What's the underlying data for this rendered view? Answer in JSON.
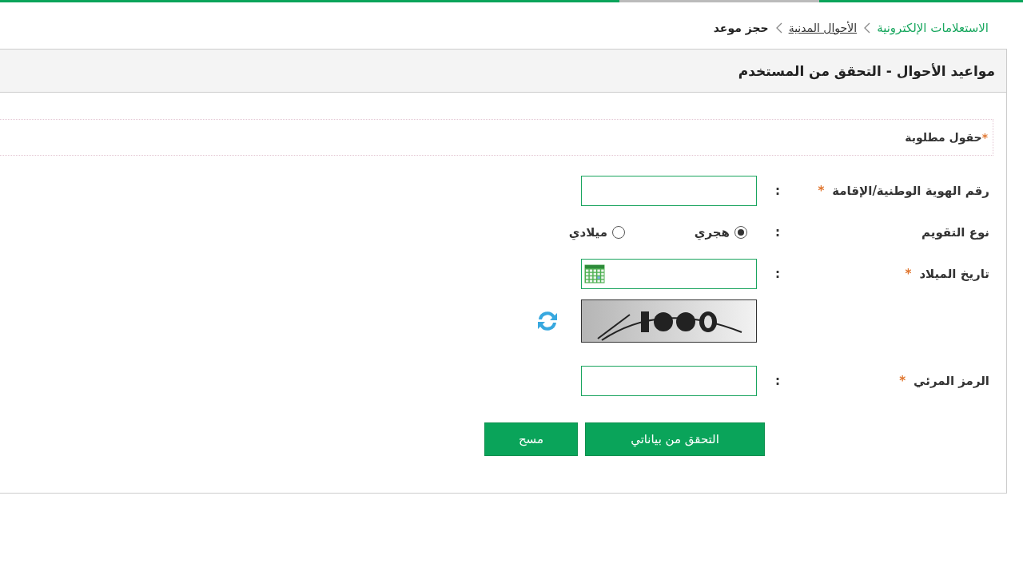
{
  "breadcrumb": [
    {
      "label": "الاستعلامات الإلكترونية",
      "kind": "link"
    },
    {
      "label": "الأحوال المدنية",
      "kind": "plain"
    },
    {
      "label": "حجز موعد",
      "kind": "current"
    }
  ],
  "panel": {
    "title": "مواعيد الأحوال - التحقق من المستخدم"
  },
  "required_note": {
    "asterisk": "*",
    "label": "حقول مطلوبة"
  },
  "fields": [
    {
      "kind": "text",
      "label": "رقم الهوية الوطنية/الإقامة",
      "required_mark": "*",
      "colon": ":"
    },
    {
      "kind": "radio",
      "label": "نوع التقويم",
      "colon": ":",
      "options": [
        {
          "label": "هجري",
          "selected": true
        },
        {
          "label": "ميلادي",
          "selected": false
        }
      ]
    },
    {
      "kind": "date",
      "label": "تاريخ الميلاد",
      "required_mark": "*",
      "colon": ":"
    },
    {
      "kind": "captcha"
    },
    {
      "kind": "text",
      "label": "الرمز المرئي",
      "required_mark": "*",
      "colon": ":"
    }
  ],
  "buttons": [
    {
      "label": "التحقق من بياناتي",
      "kind": "primary"
    },
    {
      "label": "مسح",
      "kind": "secondary"
    }
  ]
}
